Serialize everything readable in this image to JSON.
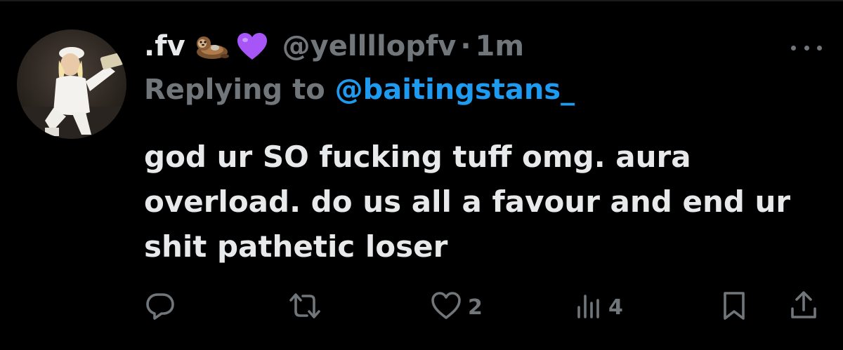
{
  "tweet": {
    "display_name": ".fv",
    "emojis": [
      "otter-emoji",
      "purple-heart-emoji"
    ],
    "handle": "@yellllopfv",
    "separator": "·",
    "time": "1m",
    "reply_prefix": "Replying to ",
    "reply_target": "@baitingstans_",
    "body_lines": [
      "god ur SO fucking tuff omg. aura",
      "overload. do us all a favour and end ur",
      "shit pathetic loser"
    ]
  },
  "actions": {
    "reply_count": "",
    "repost_count": "",
    "like_count": "2",
    "views_count": "4"
  },
  "colors": {
    "background": "#000000",
    "primary_text": "#e7e9ea",
    "secondary_text": "#71767b",
    "link": "#1d9bf0",
    "heart_emoji": "#a855f7"
  },
  "icons": [
    "more-icon",
    "reply-icon",
    "repost-icon",
    "like-icon",
    "views-icon",
    "bookmark-icon",
    "share-icon"
  ]
}
